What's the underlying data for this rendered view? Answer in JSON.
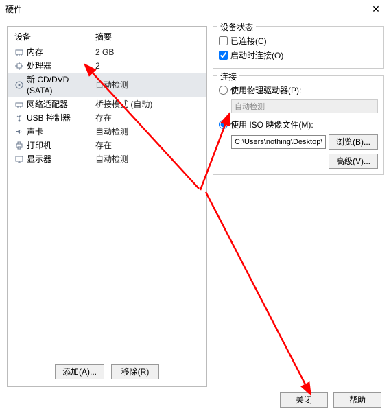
{
  "titlebar": {
    "title": "硬件"
  },
  "left": {
    "header_device": "设备",
    "header_summary": "摘要",
    "items": [
      {
        "icon": "memory-icon",
        "label": "内存",
        "summary": "2 GB"
      },
      {
        "icon": "cpu-icon",
        "label": "处理器",
        "summary": "2"
      },
      {
        "icon": "cd-icon",
        "label": "新 CD/DVD (SATA)",
        "summary": "自动检测"
      },
      {
        "icon": "network-icon",
        "label": "网络适配器",
        "summary": "桥接模式 (自动)"
      },
      {
        "icon": "usb-icon",
        "label": "USB 控制器",
        "summary": "存在"
      },
      {
        "icon": "sound-icon",
        "label": "声卡",
        "summary": "自动检测"
      },
      {
        "icon": "printer-icon",
        "label": "打印机",
        "summary": "存在"
      },
      {
        "icon": "display-icon",
        "label": "显示器",
        "summary": "自动检测"
      }
    ],
    "selected_index": 2,
    "add_label": "添加(A)...",
    "remove_label": "移除(R)"
  },
  "status": {
    "group": "设备状态",
    "connected": "已连接(C)",
    "connect_on_power": "启动时连接(O)"
  },
  "conn": {
    "group": "连接",
    "physical": "使用物理驱动器(P):",
    "physical_value": "自动检测",
    "iso": "使用 ISO 映像文件(M):",
    "iso_path": "C:\\Users\\nothing\\Desktop\\c",
    "browse": "浏览(B)...",
    "advanced": "高级(V)..."
  },
  "footer": {
    "close": "关闭",
    "help": "帮助"
  }
}
